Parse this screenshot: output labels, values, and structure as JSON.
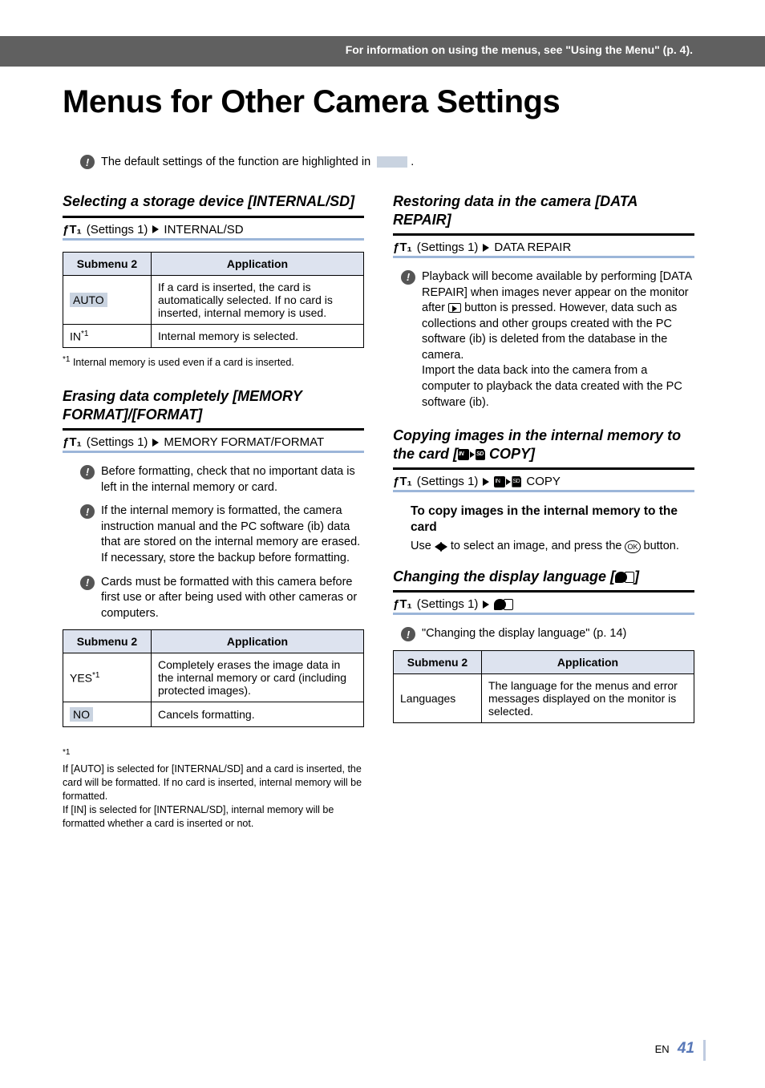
{
  "header_bar": "For information on using the menus, see \"Using the Menu\" (p. 4).",
  "page_title": "Menus for Other Camera Settings",
  "default_note_prefix": "The default settings of the function are highlighted in ",
  "default_note_suffix": ".",
  "settings_label": "(Settings 1)",
  "th_submenu": "Submenu 2",
  "th_app": "Application",
  "sec_internal": {
    "title": "Selecting a storage device [INTERNAL/SD]",
    "crumb": "INTERNAL/SD",
    "rows": [
      {
        "k": "AUTO",
        "v": "If a card is inserted, the card is automatically selected. If no card is inserted, internal memory is used."
      },
      {
        "k": "IN",
        "ksup": "*1",
        "v": "Internal memory is selected."
      }
    ],
    "foot": "Internal memory is used even if a card is inserted.",
    "foot_sup": "*1"
  },
  "sec_format": {
    "title": "Erasing data completely [MEMORY FORMAT]/[FORMAT]",
    "crumb": "MEMORY FORMAT/FORMAT",
    "notes": [
      "Before formatting, check that no important data is left in the internal memory or card.",
      "If the internal memory is formatted, the camera instruction manual and the PC software (ib) data that are stored on the internal memory are erased. If necessary, store the backup before formatting.",
      "Cards must be formatted with this camera before first use or after being used with other cameras or computers."
    ],
    "rows": [
      {
        "k": "YES",
        "ksup": "*1",
        "v": "Completely erases the image data in the internal memory or card (including protected images)."
      },
      {
        "k": "NO",
        "v": "Cancels formatting."
      }
    ],
    "foot_sup": "*1",
    "foot": "If [AUTO] is selected for [INTERNAL/SD] and a card is inserted, the card will be formatted. If no card is inserted, internal memory will be formatted.\nIf [IN] is selected for [INTERNAL/SD], internal memory will be formatted whether a card is inserted or not."
  },
  "sec_repair": {
    "title": "Restoring data in the camera [DATA REPAIR]",
    "crumb": "DATA REPAIR",
    "note": "Playback will become available by performing [DATA REPAIR] when images never appear on the monitor after      button is pressed. However, data such as collections and other groups created with the PC software (ib) is deleted from the database in the camera.\nImport the data back into the camera from a computer to playback the data created with the PC software (ib)."
  },
  "sec_copy": {
    "title_a": "Copying images in the internal memory to the card [",
    "title_b": " COPY]",
    "crumb": "COPY",
    "sub_title": "To copy images in the internal memory to the card",
    "sub_text_a": "Use ",
    "sub_text_b": " to select an image, and press the ",
    "sub_text_c": " button."
  },
  "sec_lang": {
    "title_a": "Changing the display language [",
    "title_b": "]",
    "note": "\"Changing the display language\" (p. 14)",
    "rows": [
      {
        "k": "Languages",
        "v": "The language for the menus and error messages displayed on the monitor is selected."
      }
    ]
  },
  "footer": {
    "en": "EN",
    "page": "41"
  }
}
